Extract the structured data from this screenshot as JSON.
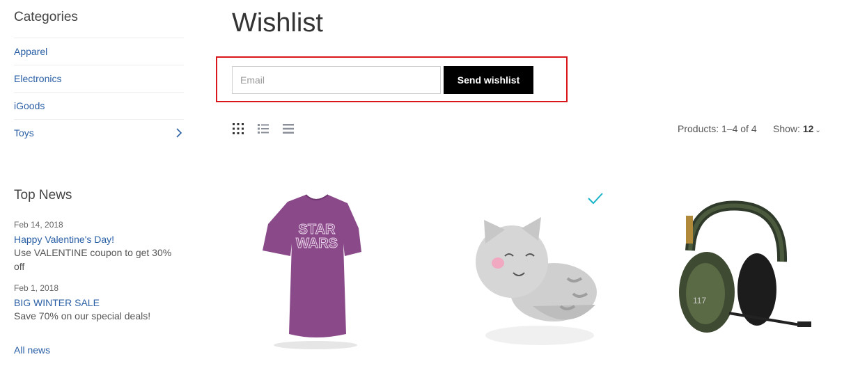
{
  "sidebar": {
    "categories_title": "Categories",
    "categories": [
      {
        "label": "Apparel"
      },
      {
        "label": "Electronics"
      },
      {
        "label": "iGoods"
      },
      {
        "label": "Toys",
        "has_children": true
      }
    ],
    "news_title": "Top News",
    "news": [
      {
        "date": "Feb 14, 2018",
        "headline": "Happy Valentine's Day!",
        "desc": "Use VALENTINE coupon to get 30% off"
      },
      {
        "date": "Feb 1, 2018",
        "headline": "BIG WINTER SALE",
        "desc": "Save 70% on our special deals!"
      }
    ],
    "all_news": "All news"
  },
  "main": {
    "title": "Wishlist",
    "email_placeholder": "Email",
    "send_label": "Send wishlist",
    "products_count": "Products: 1–4 of 4",
    "show_label": "Show:",
    "show_value": "12",
    "view_modes": [
      "grid-view-icon",
      "list-view-icon",
      "table-view-icon"
    ],
    "products": [
      {
        "image": "purple-star-wars-tshirt"
      },
      {
        "image": "plush-cat-toy",
        "selected": true
      },
      {
        "image": "green-gaming-headset"
      }
    ]
  },
  "colors": {
    "link": "#2a5fa5",
    "highlight_border": "#d9161c",
    "check": "#18b4c9",
    "button": "#000000"
  }
}
